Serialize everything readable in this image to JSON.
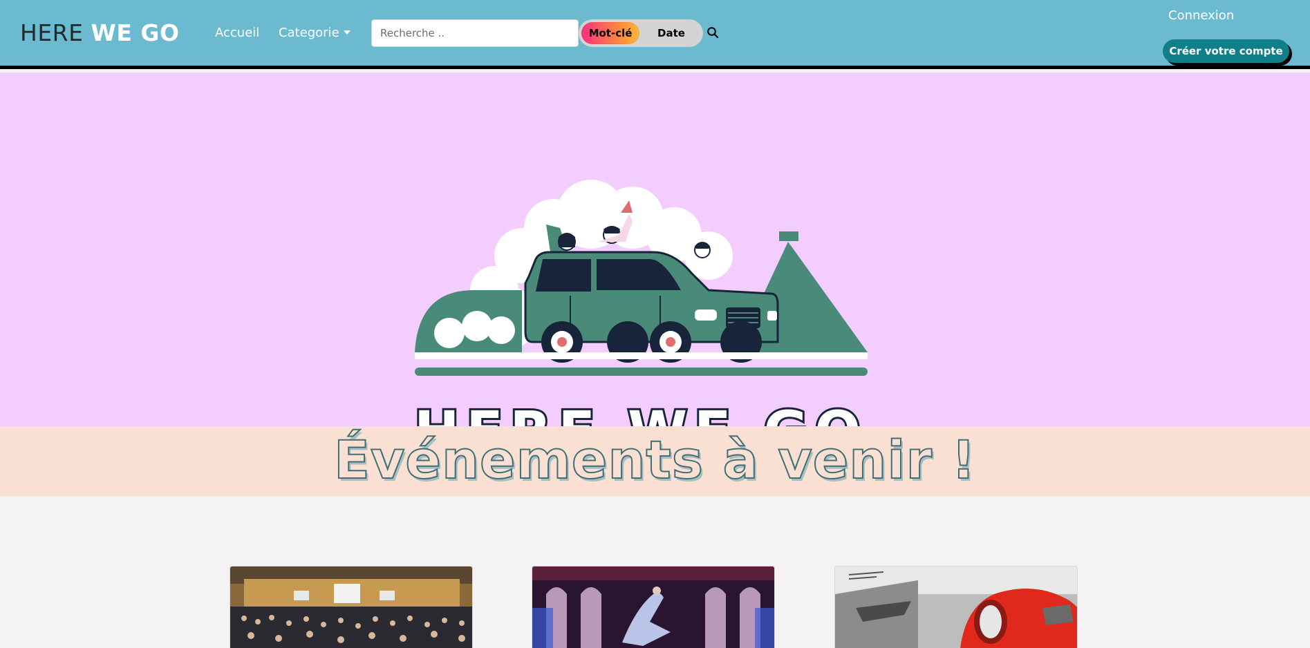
{
  "navbar": {
    "brand_light": "HERE",
    "brand_bold": "WE GO",
    "links": [
      {
        "label": "Accueil"
      },
      {
        "label": "Categorie",
        "has_dropdown": true
      }
    ],
    "search": {
      "placeholder": "Recherche ..",
      "value": "",
      "modes": [
        {
          "label": "Mot-clé",
          "active": true
        },
        {
          "label": "Date",
          "active": false
        }
      ],
      "icon": "search-icon"
    },
    "login_label": "Connexion",
    "signup_label": "Créer votre compte"
  },
  "hero": {
    "logo_text": "HERE WE GO"
  },
  "events": {
    "title": "Événements à venir !"
  },
  "cards": [
    {
      "image": "conference-hall-photo"
    },
    {
      "image": "stage-acrobat-photo"
    },
    {
      "image": "red-vintage-car-photo"
    }
  ],
  "colors": {
    "navbar_bg": "#6bbacf",
    "hero_bg": "#f3cdfd",
    "banner_bg": "#fae0d3",
    "logo_green": "#4a8a78",
    "accent_button": "#0f7f8a"
  }
}
